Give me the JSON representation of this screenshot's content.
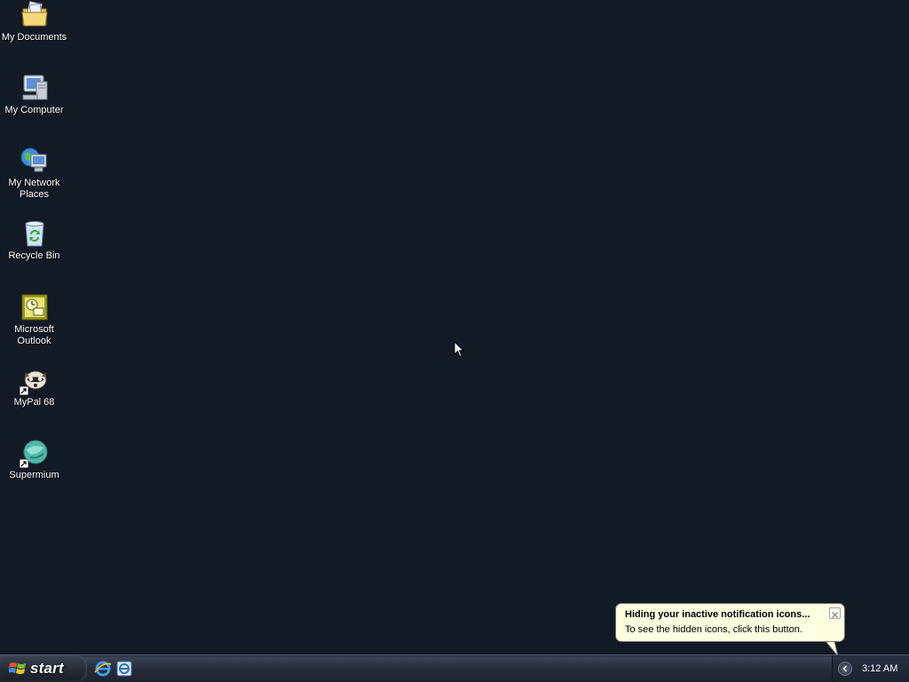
{
  "desktop": {
    "icons": [
      {
        "label": "My Documents",
        "icon": "folder-documents-icon"
      },
      {
        "label": "My Computer",
        "icon": "computer-icon"
      },
      {
        "label": "My Network Places",
        "icon": "network-places-icon"
      },
      {
        "label": "Recycle Bin",
        "icon": "recycle-bin-icon"
      },
      {
        "label": "Microsoft Outlook",
        "icon": "outlook-icon"
      },
      {
        "label": "MyPal 68",
        "icon": "mypal-icon",
        "shortcut": true
      },
      {
        "label": "Supermium",
        "icon": "supermium-icon",
        "shortcut": true
      }
    ],
    "background_color": "#121a26"
  },
  "taskbar": {
    "start_label": "start",
    "quick_launch": [
      {
        "icon": "internet-explorer-icon"
      },
      {
        "icon": "outlook-express-icon"
      }
    ],
    "clock": "3:12 AM"
  },
  "balloon": {
    "title": "Hiding your inactive notification icons...",
    "text": "To see the hidden icons, click this button.",
    "color": "#ffffe1"
  }
}
